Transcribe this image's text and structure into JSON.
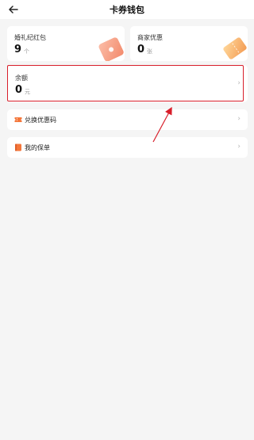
{
  "header": {
    "title": "卡券钱包",
    "back_icon": "back-arrow-icon"
  },
  "cards": {
    "wedding": {
      "label": "婚礼纪红包",
      "value": "9",
      "unit": "个",
      "icon": "gift-tag-icon"
    },
    "merchant": {
      "label": "商家优惠",
      "value": "0",
      "unit": "张",
      "icon": "coupon-ticket-icon"
    },
    "balance": {
      "label": "余额",
      "value": "0",
      "unit": "元",
      "icon": "chevron-right-icon"
    }
  },
  "rows": [
    {
      "label": "兑换优惠码",
      "icon": "ticket-icon"
    },
    {
      "label": "我的保单",
      "icon": "policy-book-icon"
    }
  ],
  "colors": {
    "accent_red": "#d81e2a",
    "icon_orange": "#f4773b",
    "deco_peach": "#f6a083",
    "deco_gold": "#f7b26a"
  }
}
